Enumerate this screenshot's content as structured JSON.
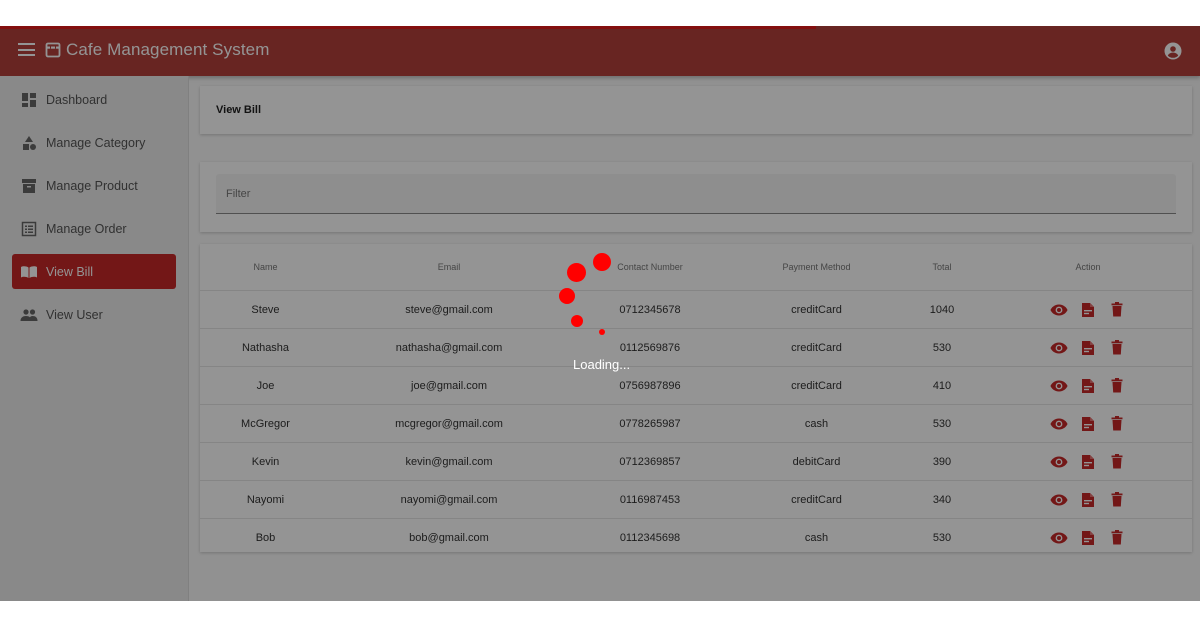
{
  "app": {
    "title": "Cafe Management System",
    "colors": {
      "toolbar": "#b3403b",
      "accent": "#c62828",
      "loader": "#ff0000"
    },
    "progress": 0.68
  },
  "sidebar": {
    "items": [
      {
        "label": "Dashboard",
        "icon": "dashboard-icon",
        "active": false
      },
      {
        "label": "Manage Category",
        "icon": "category-icon",
        "active": false
      },
      {
        "label": "Manage Product",
        "icon": "inventory-icon",
        "active": false
      },
      {
        "label": "Manage Order",
        "icon": "list-alt-icon",
        "active": false
      },
      {
        "label": "View Bill",
        "icon": "import-contacts-icon",
        "active": true
      },
      {
        "label": "View User",
        "icon": "people-icon",
        "active": false
      }
    ]
  },
  "page": {
    "title": "View Bill",
    "filter_placeholder": "Filter",
    "filter_value": ""
  },
  "table": {
    "headers": [
      "Name",
      "Email",
      "Contact Number",
      "Payment Method",
      "Total",
      "Action"
    ],
    "rows": [
      [
        "Steve",
        "steve@gmail.com",
        "0712345678",
        "creditCard",
        "1040"
      ],
      [
        "Nathasha",
        "nathasha@gmail.com",
        "0112569876",
        "creditCard",
        "530"
      ],
      [
        "Joe",
        "joe@gmail.com",
        "0756987896",
        "creditCard",
        "410"
      ],
      [
        "McGregor",
        "mcgregor@gmail.com",
        "0778265987",
        "cash",
        "530"
      ],
      [
        "Kevin",
        "kevin@gmail.com",
        "0712369857",
        "debitCard",
        "390"
      ],
      [
        "Nayomi",
        "nayomi@gmail.com",
        "0116987453",
        "creditCard",
        "340"
      ],
      [
        "Bob",
        "bob@gmail.com",
        "0112345698",
        "cash",
        "530"
      ]
    ],
    "actions": [
      "visibility-icon",
      "pdf-file-icon",
      "delete-icon"
    ]
  },
  "loading": {
    "text": "Loading..."
  }
}
